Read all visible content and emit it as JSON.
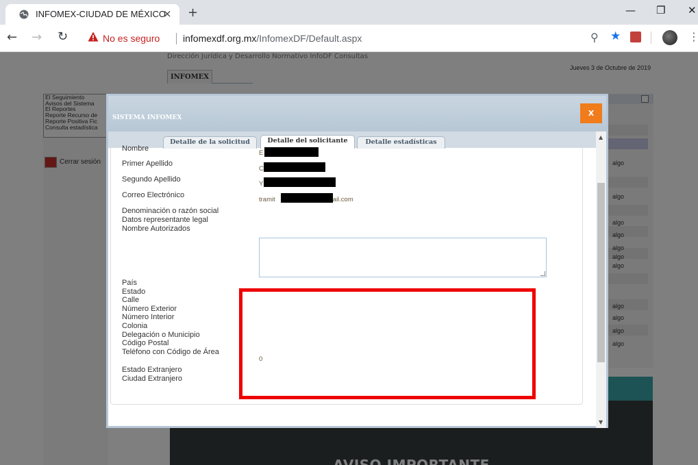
{
  "browser": {
    "tab_title": "INFOMEX-CIUDAD DE MÉXICO",
    "tab_close": "×",
    "new_tab": "+",
    "security_text": "No es seguro",
    "url_host": "infomexdf.org.mx",
    "url_path": "/InfomexDF/Default.aspx"
  },
  "page": {
    "subtitle": "Dirección Jurídica y Desarrollo Normativo InfoDF Consultas",
    "tab": "INFOMEX",
    "date": "Jueves 3 de Octubre de 2019",
    "nav_items": [
      "El Seguimiento",
      "Avisos del Sistema",
      "El Reportes",
      "Reporte Recurso de",
      "Reporte Positiva Fic",
      "Consulta estadística"
    ],
    "logout": "Cerrar sesión",
    "row_text": "algo",
    "aviso": "AVISO IMPORTANTE"
  },
  "modal": {
    "title": "SISTEMA INFOMEX",
    "close": "X",
    "tabs": [
      "Detalle de la solicitud",
      "Detalle del solicitante",
      "Detalle estadísticas"
    ],
    "active_tab": "Detalle del solicitante",
    "labels": {
      "nombre": "Nombre",
      "primer_apellido": "Primer Apellido",
      "segundo_apellido": "Segundo Apellido",
      "correo": "Correo Electrónico",
      "denominacion": "Denominación o razón social",
      "representante": "Datos representante legal",
      "autorizados": "Nombre Autorizados",
      "pais": "País",
      "estado": "Estado",
      "calle": "Calle",
      "num_ext": "Número Exterior",
      "num_int": "Número Interior",
      "colonia": "Colonia",
      "delegacion": "Delegación o Municipio",
      "cp": "Código Postal",
      "telefono": "Teléfono con Código de Área",
      "estado_ext": "Estado Extranjero",
      "ciudad_ext": "Ciudad Extranjero"
    },
    "values": {
      "nombre_prefix": "E",
      "primer_apellido_prefix": "C",
      "segundo_apellido_prefix": "Y",
      "correo_prefix": "tramit",
      "correo_suffix": "mail.com",
      "telefono": "0"
    }
  }
}
